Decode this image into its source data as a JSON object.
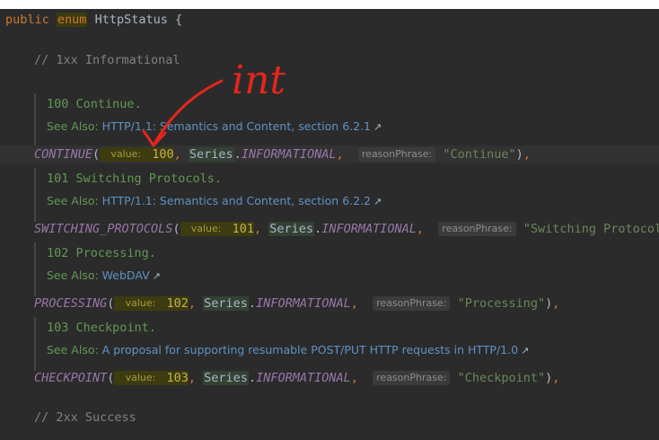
{
  "header": {
    "kw_public": "public",
    "kw_enum": "enum",
    "name": "HttpStatus",
    "brace": "{"
  },
  "comment_1xx": "// 1xx Informational",
  "comment_2xx": "// 2xx Success",
  "entries": [
    {
      "doc_title": "100 Continue.",
      "see_label": "See Also:",
      "see_link": "HTTP/1.1: Semantics and Content, section 6.2.1",
      "name": "CONTINUE",
      "value_hint": "value:",
      "value": "100",
      "series_class": "Series",
      "series_const": "INFORMATIONAL",
      "reason_hint": "reasonPhrase:",
      "reason": "\"Continue\""
    },
    {
      "doc_title": "101 Switching Protocols.",
      "see_label": "See Also:",
      "see_link": "HTTP/1.1: Semantics and Content, section 6.2.2",
      "name": "SWITCHING_PROTOCOLS",
      "value_hint": "value:",
      "value": "101",
      "series_class": "Series",
      "series_const": "INFORMATIONAL",
      "reason_hint": "reasonPhrase:",
      "reason": "\"Switching Protocols\""
    },
    {
      "doc_title": "102 Processing.",
      "see_label": "See Also:",
      "see_link": "WebDAV",
      "name": "PROCESSING",
      "value_hint": "value:",
      "value": "102",
      "series_class": "Series",
      "series_const": "INFORMATIONAL",
      "reason_hint": "reasonPhrase:",
      "reason": "\"Processing\""
    },
    {
      "doc_title": "103 Checkpoint.",
      "see_label": "See Also:",
      "see_link": "A proposal for supporting resumable POST/PUT HTTP requests in HTTP/1.0",
      "name": "CHECKPOINT",
      "value_hint": "value:",
      "value": "103",
      "series_class": "Series",
      "series_const": "INFORMATIONAL",
      "reason_hint": "reasonPhrase:",
      "reason": "\"Checkpoint\""
    }
  ],
  "annotation": "int",
  "icons": {
    "link_arrow": "external-link-arrow-icon"
  },
  "colors": {
    "background": "#2b2b2b",
    "keyword": "#cc7832",
    "constant": "#9876aa",
    "string": "#6a8759",
    "doc": "#629755",
    "link": "#5f92c4",
    "annotation": "#e3261c"
  }
}
